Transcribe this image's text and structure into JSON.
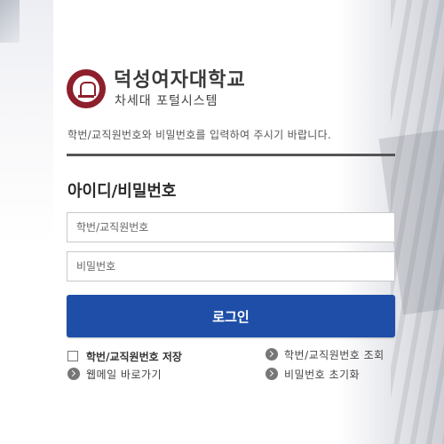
{
  "header": {
    "school_name": "덕성여자대학교",
    "system_name": "차세대 포털시스템"
  },
  "guide_text": "학번/교직원번호와 비밀번호를 입력하여 주시기 바랍니다.",
  "login_form": {
    "section_title": "아이디/비밀번호",
    "id_placeholder": "학번/교직원번호",
    "id_value": "",
    "password_placeholder": "비밀번호",
    "password_value": "",
    "login_button_label": "로그인",
    "save_id_label": "학번/교직원번호 저장",
    "save_id_checked": false
  },
  "links": {
    "webmail": "웹메일 바로가기",
    "find_id": "학번/교직원번호 조회",
    "reset_password": "비밀번호 초기화"
  },
  "colors": {
    "accent": "#1f4ea8",
    "brand": "#8e1f2c",
    "divider": "#555555"
  },
  "icons": {
    "logo": "university-seal-icon",
    "link_arrow": "chevron-right-circle-icon"
  }
}
